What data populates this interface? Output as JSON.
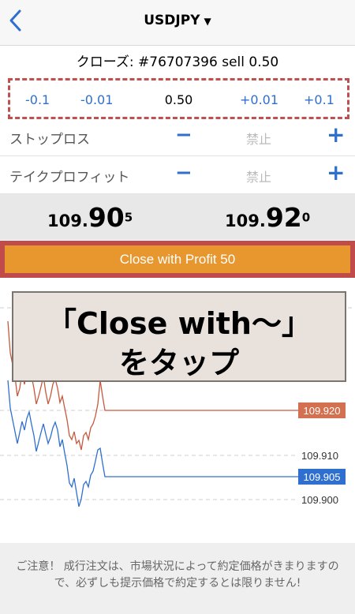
{
  "nav": {
    "title": "USDJPY",
    "caret": "▼"
  },
  "order": {
    "info": "クローズ: #76707396 sell 0.50"
  },
  "volume": {
    "minus_large": "-0.1",
    "minus_small": "-0.01",
    "value": "0.50",
    "plus_small": "+0.01",
    "plus_large": "+0.1"
  },
  "stop_loss": {
    "label": "ストップロス",
    "value": "禁止",
    "minus": "−",
    "plus": "+"
  },
  "take_profit": {
    "label": "テイクプロフィット",
    "value": "禁止",
    "minus": "−",
    "plus": "+"
  },
  "prices": {
    "bid": {
      "small": "109.",
      "big": "90",
      "sup": "5"
    },
    "ask": {
      "small": "109.",
      "big": "92",
      "sup": "0"
    }
  },
  "close_button": {
    "label": "Close with Profit 50"
  },
  "callout": {
    "line1": "「Close with～」",
    "line2": "をタップ"
  },
  "chart_data": {
    "type": "line",
    "series": [
      {
        "color": "#d2704f",
        "last_value": 109.92
      },
      {
        "color": "#2f6fd0",
        "last_value": 109.905
      }
    ],
    "price_labels": [
      "109.920",
      "109.910",
      "109.905",
      "109.900"
    ],
    "grid": true
  },
  "warning": {
    "text": "ご注意！ 成行注文は、市場状況によって約定価格がきまりますので、必ずしも提示価格で約定するとは限りません!"
  },
  "colors": {
    "accent": "#2f6fd0",
    "close_button": "#e8962e",
    "highlight": "#c0504f"
  }
}
